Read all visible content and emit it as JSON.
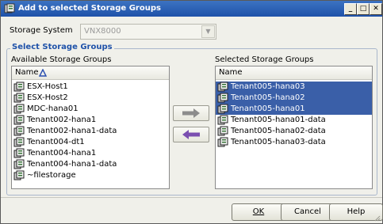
{
  "window": {
    "title": "Add to selected Storage Groups",
    "icon": "storage-group-icon",
    "controls": [
      "minimize-icon",
      "maximize-icon",
      "close-icon"
    ]
  },
  "storage_system": {
    "label": "Storage System",
    "value": "VNX8000"
  },
  "group": {
    "title": "Select Storage Groups",
    "available": {
      "label": "Available Storage Groups",
      "column": "Name",
      "items": [
        "ESX-Host1",
        "ESX-Host2",
        "MDC-hana01",
        "Tenant002-hana1",
        "Tenant002-hana1-data",
        "Tenant004-dt1",
        "Tenant004-hana1",
        "Tenant004-hana1-data",
        "~filestorage"
      ]
    },
    "selected": {
      "label": "Selected Storage Groups",
      "column": "Name",
      "items": [
        "Tenant005-hana03",
        "Tenant005-hana02",
        "Tenant005-hana01",
        "Tenant005-hana01-data",
        "Tenant005-hana02-data",
        "Tenant005-hana03-data"
      ],
      "highlighted_count": 3
    }
  },
  "buttons": {
    "ok_label": "OK",
    "cancel_label": "Cancel",
    "help_label": "Help"
  },
  "colors": {
    "title_bar": "#1f52a9",
    "selection": "#3a5fa8",
    "group_title": "#1f52a9",
    "add_arrow": "#8c8c8c",
    "remove_arrow": "#7b4fb0"
  }
}
